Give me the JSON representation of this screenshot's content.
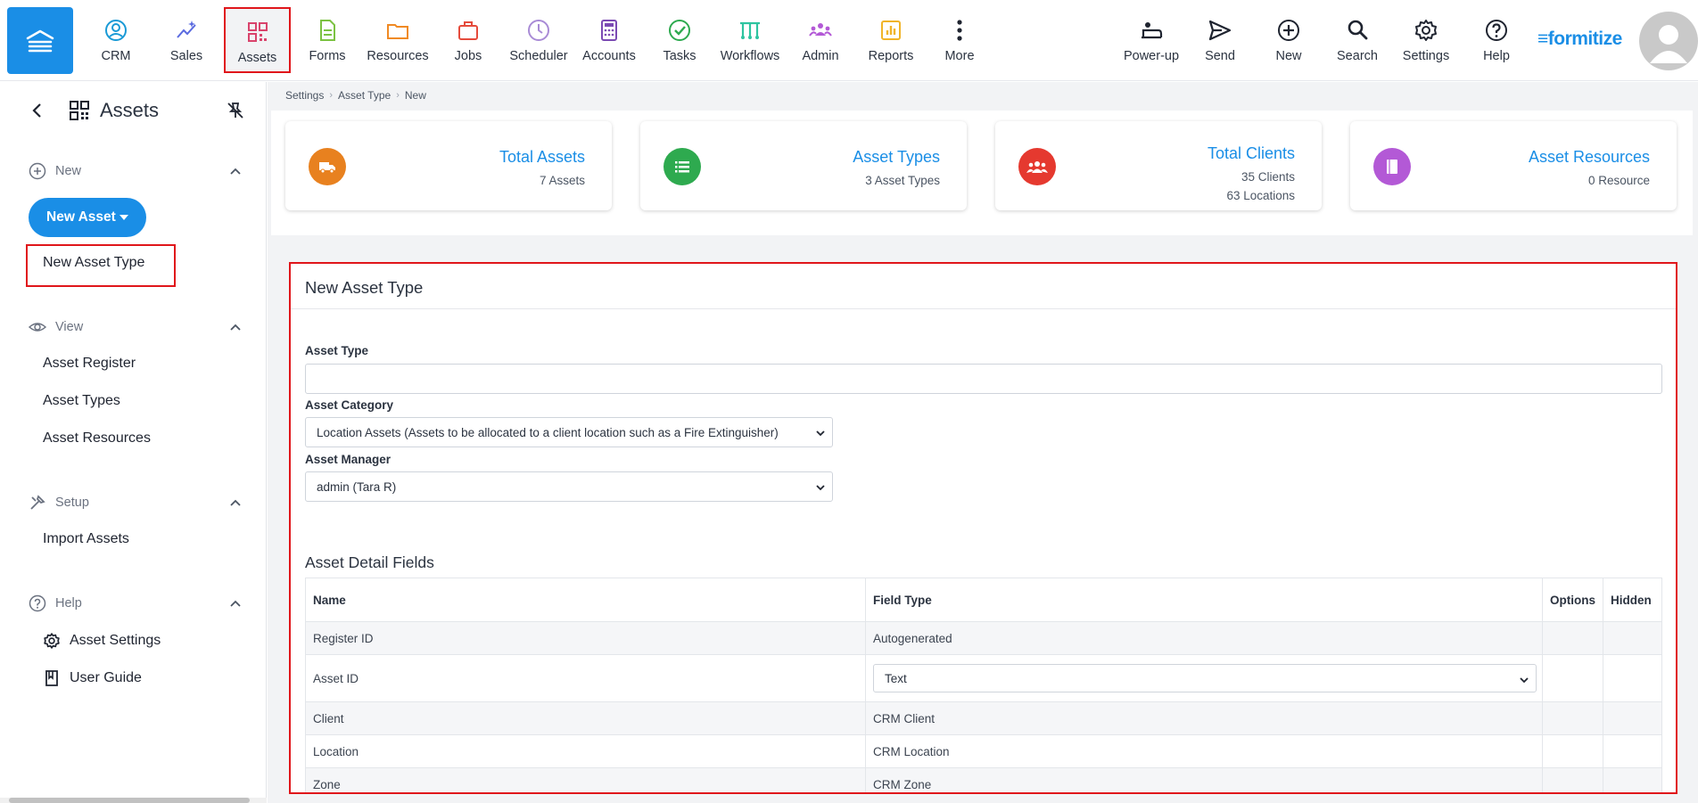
{
  "nav": {
    "items": [
      {
        "label": "CRM",
        "icon": "crm-icon"
      },
      {
        "label": "Sales",
        "icon": "sales-icon"
      },
      {
        "label": "Assets",
        "icon": "assets-icon"
      },
      {
        "label": "Forms",
        "icon": "forms-icon"
      },
      {
        "label": "Resources",
        "icon": "resources-icon"
      },
      {
        "label": "Jobs",
        "icon": "jobs-icon"
      },
      {
        "label": "Scheduler",
        "icon": "scheduler-icon"
      },
      {
        "label": "Accounts",
        "icon": "accounts-icon"
      },
      {
        "label": "Tasks",
        "icon": "tasks-icon"
      },
      {
        "label": "Workflows",
        "icon": "workflows-icon"
      },
      {
        "label": "Admin",
        "icon": "admin-icon"
      },
      {
        "label": "Reports",
        "icon": "reports-icon"
      },
      {
        "label": "More",
        "icon": "more-icon"
      }
    ],
    "tools": [
      {
        "label": "Power-up",
        "icon": "power-up-icon"
      },
      {
        "label": "Send",
        "icon": "send-icon"
      },
      {
        "label": "New",
        "icon": "plus-circle-icon"
      },
      {
        "label": "Search",
        "icon": "search-icon"
      },
      {
        "label": "Settings",
        "icon": "gear-icon"
      },
      {
        "label": "Help",
        "icon": "help-icon"
      }
    ],
    "brand": "formitize",
    "active": "Assets"
  },
  "sidebar": {
    "title": "Assets",
    "sections": {
      "new": "New",
      "view": "View",
      "setup": "Setup",
      "help": "Help"
    },
    "new_asset_button": "New Asset",
    "new_asset_type": "New Asset Type",
    "view_links": [
      "Asset Register",
      "Asset Types",
      "Asset Resources"
    ],
    "setup_links": [
      "Import Assets"
    ],
    "help_links": [
      "Asset Settings",
      "User Guide"
    ]
  },
  "breadcrumb": [
    "Settings",
    "Asset Type",
    "New"
  ],
  "stats": [
    {
      "title": "Total Assets",
      "lines": [
        "7 Assets"
      ],
      "color": "#e8811f",
      "icon": "truck-icon"
    },
    {
      "title": "Asset Types",
      "lines": [
        "3 Asset Types"
      ],
      "color": "#2eaa4f",
      "icon": "list-icon"
    },
    {
      "title": "Total Clients",
      "lines": [
        "35 Clients",
        "63 Locations"
      ],
      "color": "#e5392f",
      "icon": "users-icon"
    },
    {
      "title": "Asset Resources",
      "lines": [
        "0 Resource"
      ],
      "color": "#b359d6",
      "icon": "book-icon"
    }
  ],
  "form": {
    "title": "New Asset Type",
    "asset_type_label": "Asset Type",
    "asset_type_value": "",
    "asset_category_label": "Asset Category",
    "asset_category_value": "Location Assets (Assets to be allocated to a client location such as a Fire Extinguisher)",
    "asset_manager_label": "Asset Manager",
    "asset_manager_value": "admin (Tara R)",
    "detail_title": "Asset Detail Fields",
    "columns": [
      "Name",
      "Field Type",
      "Options",
      "Hidden"
    ],
    "rows": [
      {
        "name": "Register ID",
        "type": "Autogenerated",
        "select": false
      },
      {
        "name": "Asset ID",
        "type": "Text",
        "select": true
      },
      {
        "name": "Client",
        "type": "CRM Client",
        "select": false
      },
      {
        "name": "Location",
        "type": "CRM Location",
        "select": false
      },
      {
        "name": "Zone",
        "type": "CRM Zone",
        "select": false
      }
    ]
  },
  "colors": {
    "accent": "#1a8ee6",
    "highlight": "#e0161b"
  }
}
